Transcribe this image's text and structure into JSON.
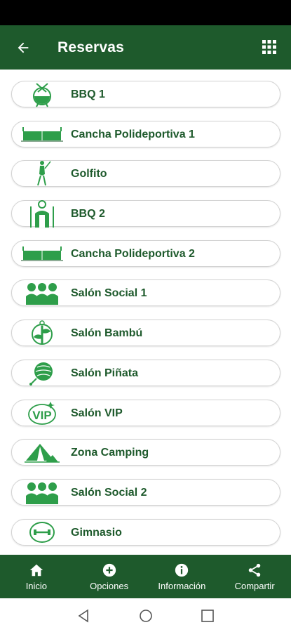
{
  "app_bar": {
    "title": "Reservas"
  },
  "items": [
    {
      "label": "BBQ 1",
      "icon": "bbq-grill-icon"
    },
    {
      "label": "Cancha Polideportiva 1",
      "icon": "sports-court-icon"
    },
    {
      "label": "Golfito",
      "icon": "golfer-icon"
    },
    {
      "label": "BBQ 2",
      "icon": "chef-icon"
    },
    {
      "label": "Cancha Polideportiva 2",
      "icon": "sports-court-icon"
    },
    {
      "label": "Salón Social 1",
      "icon": "people-group-icon"
    },
    {
      "label": "Salón Bambú",
      "icon": "bamboo-icon"
    },
    {
      "label": "Salón Piñata",
      "icon": "pinata-icon"
    },
    {
      "label": "Salón VIP",
      "icon": "vip-icon"
    },
    {
      "label": "Zona Camping",
      "icon": "tent-icon"
    },
    {
      "label": "Salón Social 2",
      "icon": "people-group-icon"
    },
    {
      "label": "Gimnasio",
      "icon": "gym-icon"
    }
  ],
  "bottom_nav": [
    {
      "label": "Inicio",
      "icon": "home-icon"
    },
    {
      "label": "Opciones",
      "icon": "plus-circle-icon"
    },
    {
      "label": "Información",
      "icon": "info-icon"
    },
    {
      "label": "Compartir",
      "icon": "share-icon"
    }
  ],
  "colors": {
    "primary": "#1e5a2c",
    "accent": "#2e9e4a"
  }
}
